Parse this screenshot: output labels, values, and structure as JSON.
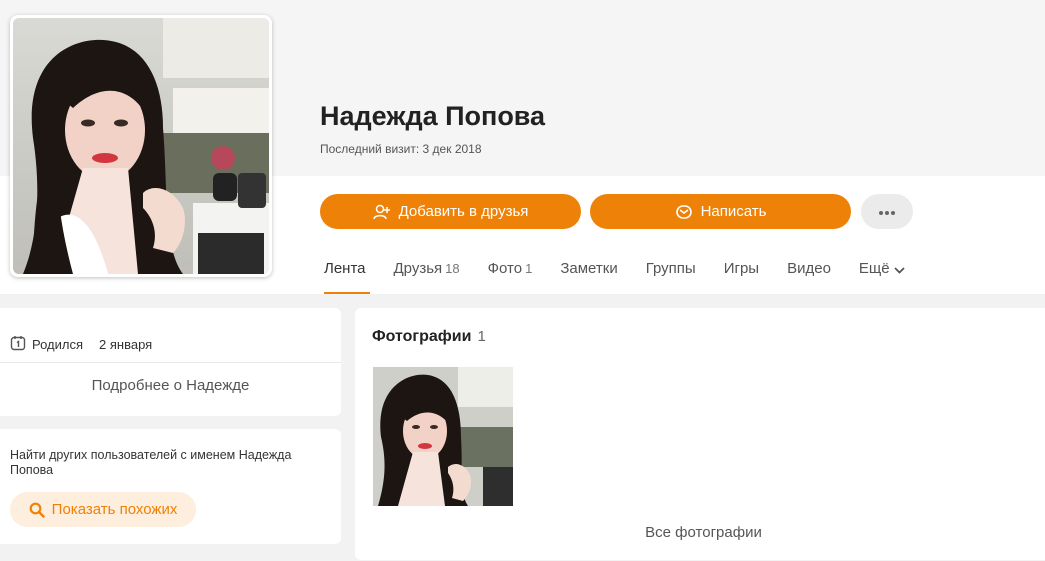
{
  "profile": {
    "name": "Надежда Попова",
    "last_visit_label": "Последний визит:",
    "last_visit_value": "3 дек 2018"
  },
  "actions": {
    "add_friend": "Добавить в друзья",
    "write": "Написать",
    "more": "···"
  },
  "tabs": [
    {
      "label": "Лента",
      "count": ""
    },
    {
      "label": "Друзья",
      "count": "18"
    },
    {
      "label": "Фото",
      "count": "1"
    },
    {
      "label": "Заметки",
      "count": ""
    },
    {
      "label": "Группы",
      "count": ""
    },
    {
      "label": "Игры",
      "count": ""
    },
    {
      "label": "Видео",
      "count": ""
    },
    {
      "label": "Ещё",
      "count": ""
    }
  ],
  "info": {
    "born_label": "Родился",
    "born_value": "2 января",
    "more_about": "Подробнее о Надежде"
  },
  "find": {
    "text": "Найти других пользователей с именем Надежда Попова",
    "button": "Показать похожих"
  },
  "photos": {
    "title": "Фотографии",
    "count": "1",
    "all_link": "Все фотографии"
  },
  "colors": {
    "accent": "#ee8208",
    "accent_light": "#fdeedd"
  },
  "icons": {
    "add_friend": "add-user-icon",
    "write": "envelope-icon",
    "born": "calendar-icon",
    "similar": "search-icon",
    "more_tab": "chevron-down-icon"
  }
}
